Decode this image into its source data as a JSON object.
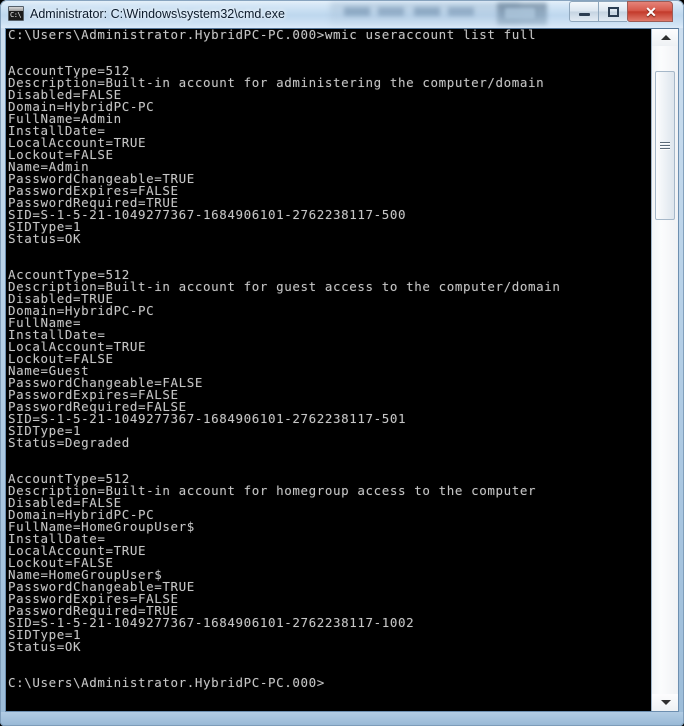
{
  "window": {
    "title": "Administrator: C:\\Windows\\system32\\cmd.exe",
    "icon_name": "cmd-console-icon",
    "icon_glyph": "C:\\",
    "controls": {
      "minimize_label": "–",
      "maximize_label": "□",
      "close_label": "✕"
    },
    "colors": {
      "console_background": "#000000",
      "console_text": "#c6c6c6",
      "title_text": "#0b1a2b",
      "close_button": "#c33a2b",
      "frame_glass": "#b9d2e8"
    }
  },
  "scrollbar": {
    "up_arrow_label": "▲",
    "down_arrow_label": "▼",
    "thumb_position_percent": 5,
    "thumb_size_percent": 23
  },
  "console": {
    "command_line": "C:\\Users\\Administrator.HybridPC-PC.000>wmic useraccount list full",
    "prompt": "C:\\Users\\Administrator.HybridPC-PC.000>",
    "command": "wmic useraccount list full",
    "accounts": [
      {
        "AccountType": "512",
        "Description": "Built-in account for administering the computer/domain",
        "Disabled": "FALSE",
        "Domain": "HybridPC-PC",
        "FullName": "Admin",
        "InstallDate": "",
        "LocalAccount": "TRUE",
        "Lockout": "FALSE",
        "Name": "Admin",
        "PasswordChangeable": "TRUE",
        "PasswordExpires": "FALSE",
        "PasswordRequired": "TRUE",
        "SID": "S-1-5-21-1049277367-1684906101-2762238117-500",
        "SIDType": "1",
        "Status": "OK"
      },
      {
        "AccountType": "512",
        "Description": "Built-in account for guest access to the computer/domain",
        "Disabled": "TRUE",
        "Domain": "HybridPC-PC",
        "FullName": "",
        "InstallDate": "",
        "LocalAccount": "TRUE",
        "Lockout": "FALSE",
        "Name": "Guest",
        "PasswordChangeable": "FALSE",
        "PasswordExpires": "FALSE",
        "PasswordRequired": "FALSE",
        "SID": "S-1-5-21-1049277367-1684906101-2762238117-501",
        "SIDType": "1",
        "Status": "Degraded"
      },
      {
        "AccountType": "512",
        "Description": "Built-in account for homegroup access to the computer",
        "Disabled": "FALSE",
        "Domain": "HybridPC-PC",
        "FullName": "HomeGroupUser$",
        "InstallDate": "",
        "LocalAccount": "TRUE",
        "Lockout": "FALSE",
        "Name": "HomeGroupUser$",
        "PasswordChangeable": "TRUE",
        "PasswordExpires": "FALSE",
        "PasswordRequired": "TRUE",
        "SID": "S-1-5-21-1049277367-1684906101-2762238117-1002",
        "SIDType": "1",
        "Status": "OK"
      }
    ],
    "field_order": [
      "AccountType",
      "Description",
      "Disabled",
      "Domain",
      "FullName",
      "InstallDate",
      "LocalAccount",
      "Lockout",
      "Name",
      "PasswordChangeable",
      "PasswordExpires",
      "PasswordRequired",
      "SID",
      "SIDType",
      "Status"
    ],
    "trailing_prompt": "C:\\Users\\Administrator.HybridPC-PC.000>"
  }
}
